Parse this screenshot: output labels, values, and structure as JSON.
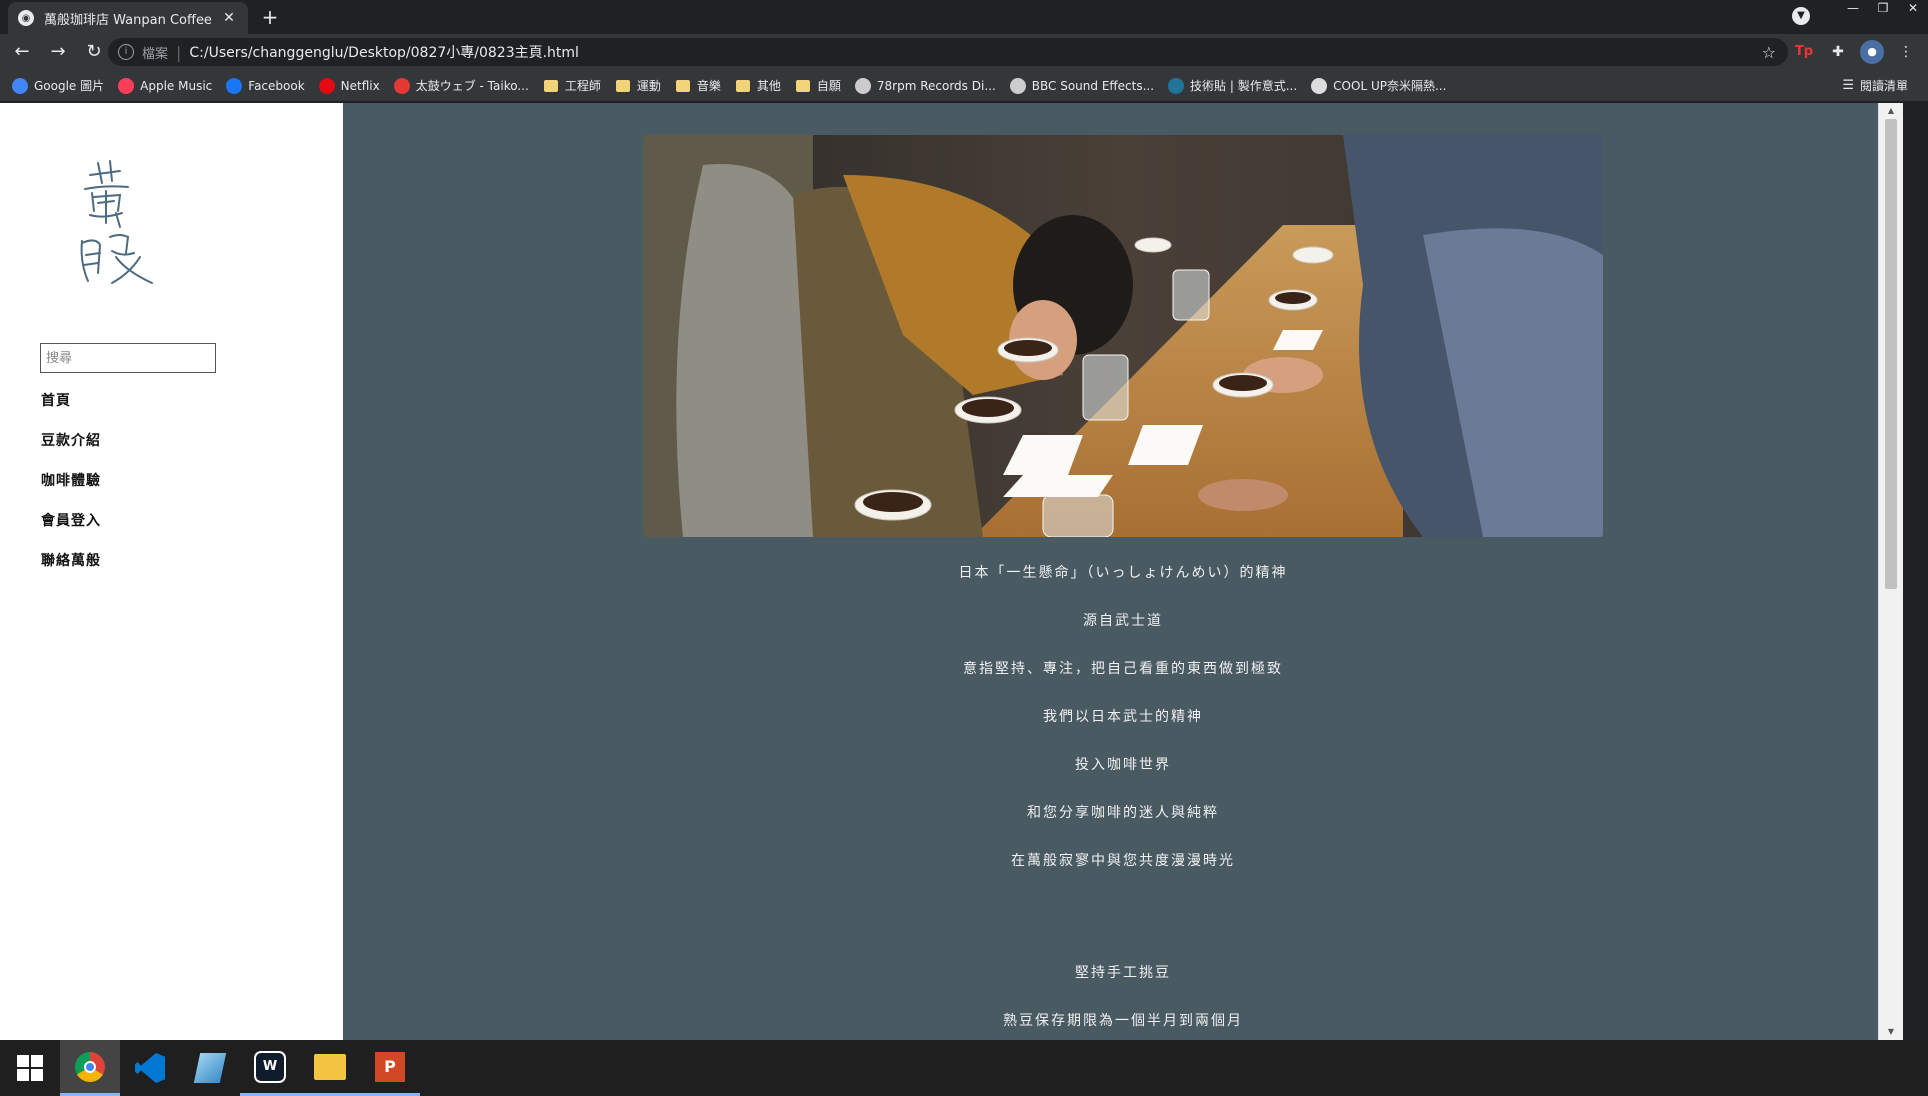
{
  "browser": {
    "tab_title": "萬般珈琲店 Wanpan Coffee",
    "tab_close": "✕",
    "new_tab": "+",
    "url_scheme": "檔案",
    "url": "C:/Users/changgenglu/Desktop/0827小專/0823主頁.html",
    "window_controls": [
      "—",
      "❐",
      "✕"
    ],
    "extension_tp": "Tp",
    "reading_list": "閱讀清單"
  },
  "bookmarks": [
    {
      "label": "Google 圖片",
      "icon": "google-icon",
      "color": "#4285f4"
    },
    {
      "label": "Apple Music",
      "icon": "apple-music-icon",
      "color": "#fa3e5a"
    },
    {
      "label": "Facebook",
      "icon": "facebook-icon",
      "color": "#1877f2"
    },
    {
      "label": "Netflix",
      "icon": "netflix-icon",
      "color": "#e50914"
    },
    {
      "label": "太鼓ウェブ - Taiko...",
      "icon": "taiko-icon",
      "color": "#e53935"
    },
    {
      "label": "工程師",
      "icon": "folder-icon",
      "color": "#f2d37a"
    },
    {
      "label": "運動",
      "icon": "folder-icon",
      "color": "#f2d37a"
    },
    {
      "label": "音樂",
      "icon": "folder-icon",
      "color": "#f2d37a"
    },
    {
      "label": "其他",
      "icon": "folder-icon",
      "color": "#f2d37a"
    },
    {
      "label": "自願",
      "icon": "folder-icon",
      "color": "#f2d37a"
    },
    {
      "label": "78rpm Records Di...",
      "icon": "records-icon",
      "color": "#cccccc"
    },
    {
      "label": "BBC Sound Effects...",
      "icon": "bbc-icon",
      "color": "#cccccc"
    },
    {
      "label": "技術貼 | 製作意式...",
      "icon": "wordpress-icon",
      "color": "#21759b"
    },
    {
      "label": "COOL UP奈米隔熱...",
      "icon": "coolup-icon",
      "color": "#dddddd"
    }
  ],
  "sidebar": {
    "search_placeholder": "搜尋",
    "nav": [
      "首頁",
      "豆款介紹",
      "咖啡體驗",
      "會員登入",
      "聯絡萬般"
    ]
  },
  "main": {
    "lines": [
      "日本「一生懸命」（いっしょけんめい）的精神",
      "源自武士道",
      "意指堅持、專注，把自己看重的東西做到極致",
      "我們以日本武士的精神",
      "投入咖啡世界",
      "和您分享咖啡的迷人與純粹",
      "在萬般寂寥中與您共度漫漫時光",
      "",
      "堅持手工挑豆",
      "熟豆保存期限為一個半月到兩個月"
    ]
  },
  "colors": {
    "main_bg": "#4a5a63",
    "sidebar_bg": "#ffffff",
    "logo_ink": "#4d6b80"
  }
}
